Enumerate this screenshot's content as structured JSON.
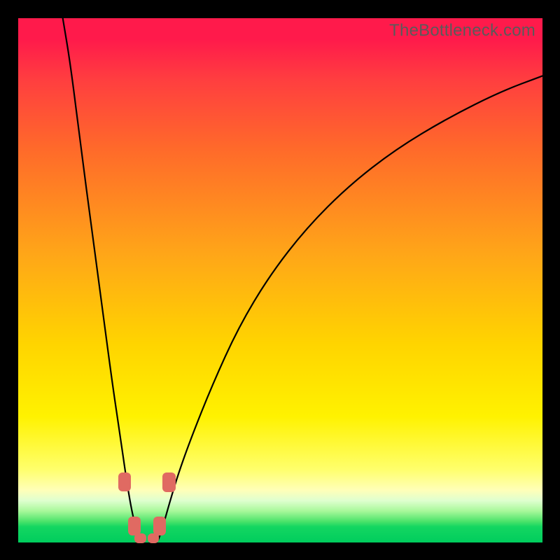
{
  "watermark": "TheBottleneck.com",
  "chart_data": {
    "type": "line",
    "title": "",
    "xlabel": "",
    "ylabel": "",
    "xlim": [
      0,
      100
    ],
    "ylim": [
      0,
      100
    ],
    "series": [
      {
        "name": "left-branch",
        "x": [
          8.5,
          10,
          12,
          14,
          16,
          18,
          19.5,
          20.5,
          21.3,
          22,
          22.7,
          23.3
        ],
        "values": [
          100,
          91,
          75,
          60,
          45,
          30,
          20,
          13,
          8,
          4.5,
          2,
          0.5
        ]
      },
      {
        "name": "right-branch",
        "x": [
          26.7,
          27.3,
          28,
          29,
          30.5,
          33,
          37,
          42,
          48,
          55,
          63,
          72,
          82,
          92,
          100
        ],
        "values": [
          0.5,
          2,
          4.5,
          8,
          13,
          20,
          30,
          41,
          51,
          60,
          68,
          75,
          81,
          86,
          89
        ]
      }
    ],
    "markers": [
      {
        "name": "left-upper",
        "x": 20.3,
        "y": 11.5,
        "w": 2.4,
        "h": 3.6
      },
      {
        "name": "left-lower",
        "x": 22.1,
        "y": 3.2,
        "w": 2.4,
        "h": 3.6
      },
      {
        "name": "floor-left",
        "x": 23.3,
        "y": 0.8,
        "w": 2.2,
        "h": 2.0
      },
      {
        "name": "floor-right",
        "x": 25.8,
        "y": 0.8,
        "w": 2.2,
        "h": 2.0
      },
      {
        "name": "right-lower",
        "x": 27.0,
        "y": 3.2,
        "w": 2.4,
        "h": 3.6
      },
      {
        "name": "right-upper",
        "x": 28.8,
        "y": 11.5,
        "w": 2.6,
        "h": 3.8
      }
    ],
    "colors": {
      "curve": "#000000",
      "marker": "#e06a62"
    }
  }
}
